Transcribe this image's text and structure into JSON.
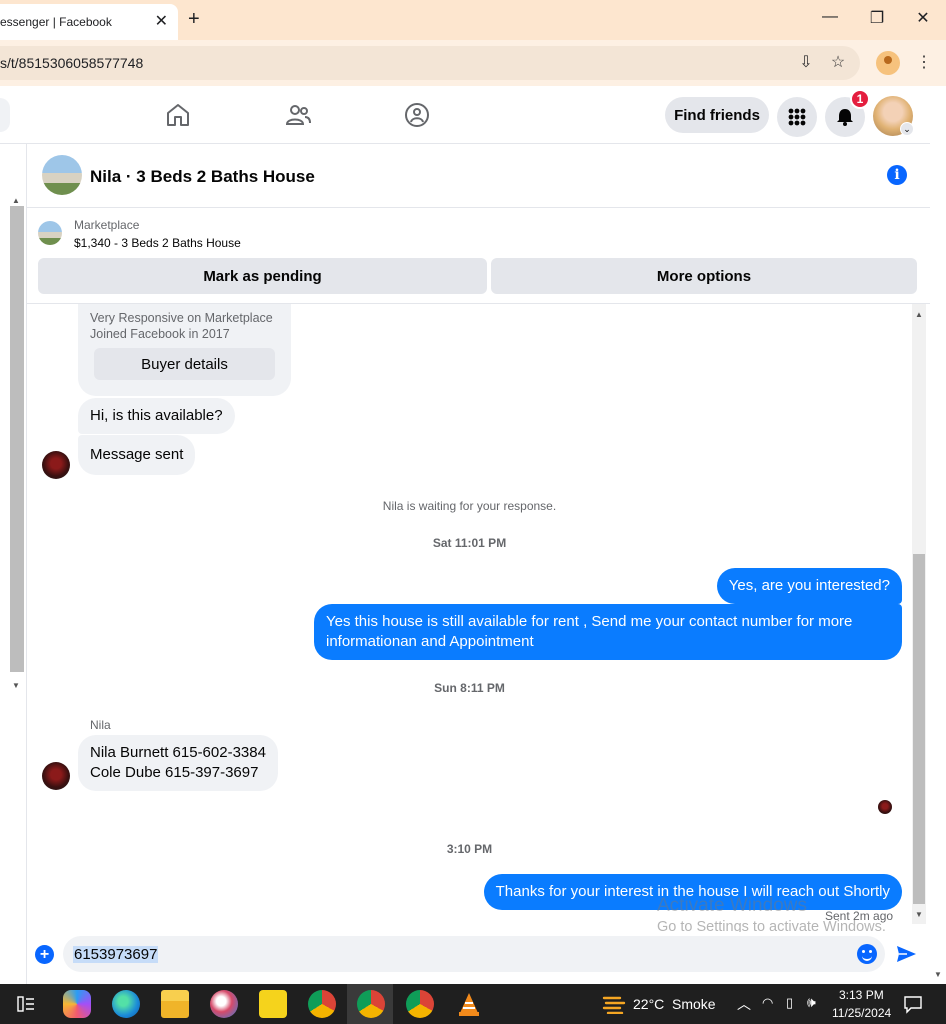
{
  "browser": {
    "tab_title": "Messenger | Facebook",
    "url": "s/t/8515306058577748",
    "window_controls": [
      "minimize-icon",
      "restore-icon",
      "close-icon"
    ]
  },
  "fb_nav": {
    "find_friends": "Find friends",
    "notification_count": "1"
  },
  "chat": {
    "title": "Nila · 3 Beds 2 Baths House",
    "marketplace_label": "Marketplace",
    "listing": "$1,340 - 3 Beds 2 Baths House",
    "mark_pending": "Mark as pending",
    "more_options": "More options"
  },
  "profile_card": {
    "line1": "Very Responsive on Marketplace",
    "line2": "Joined Facebook in 2017",
    "buyer_details": "Buyer details"
  },
  "messages": {
    "in1": "Hi, is this available?",
    "in2": "Message sent",
    "system": "Nila is waiting for your response.",
    "ts1": "Sat 11:01 PM",
    "out1": "Yes, are you interested?",
    "out2": "Yes this house is still available for rent , Send me your contact number for more informationan and Appointment",
    "ts2": "Sun 8:11 PM",
    "sender": "Nila",
    "in3_line1": "Nila Burnett 615-602-3384",
    "in3_line2": "Cole Dube 615-397-3697",
    "ts3": "3:10 PM",
    "out3": "Thanks for your interest in the house I will reach out Shortly",
    "sent_status": "Sent 2m ago"
  },
  "watermark": {
    "line1": "Activate Windows",
    "line2": "Go to Settings to activate Windows."
  },
  "composer": {
    "value": "6153973697"
  },
  "taskbar": {
    "weather": "22°C",
    "weather_desc": "Smoke",
    "time": "3:13 PM",
    "date": "11/25/2024"
  },
  "colors": {
    "messenger_blue": "#0a7cff",
    "fb_blue": "#0866ff",
    "badge_red": "#e41e3f"
  }
}
